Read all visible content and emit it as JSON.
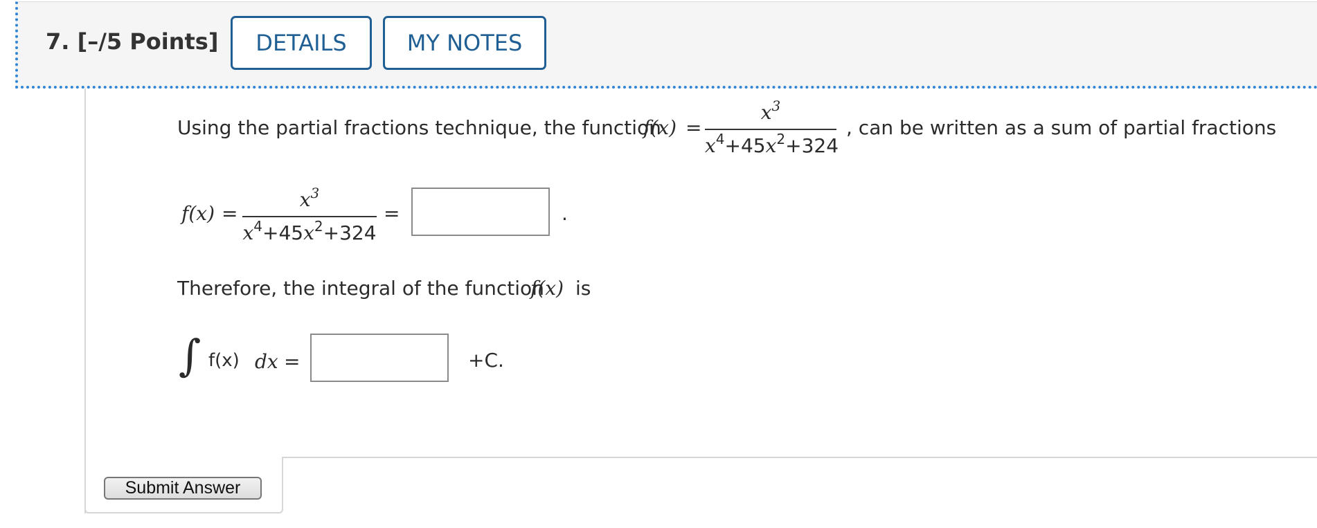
{
  "header": {
    "question_label": "7.  [–/5 Points]",
    "details_button": "DETAILS",
    "notes_button": "MY NOTES"
  },
  "prompt": {
    "lead": "Using the partial fractions technique, the function",
    "func": "f(x)",
    "eq": "=",
    "fraction": {
      "numerator": "x3",
      "denominator": "x4+45x2+324"
    },
    "tail": ", can be written as a sum of partial fractions"
  },
  "equation1": {
    "lhs": "f(x)",
    "eq1": "=",
    "eq2": "=",
    "period": "."
  },
  "therefore": {
    "text": "Therefore, the integral of the function",
    "func": "f(x)",
    "is": "is"
  },
  "equation2": {
    "integral_symbol": "∫",
    "integrand": "f(x)",
    "dx": "dx",
    "eq": "=",
    "constant": "+C."
  },
  "submit_button": "Submit Answer"
}
